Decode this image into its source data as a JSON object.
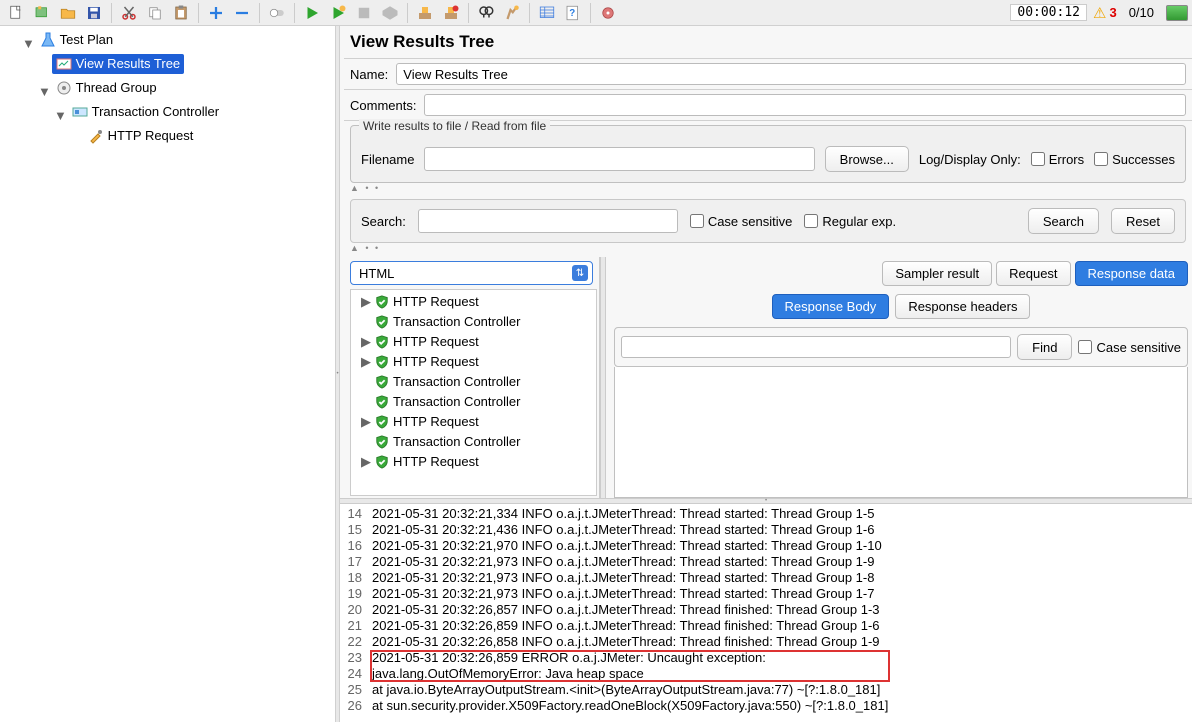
{
  "toolbar": {
    "timer": "00:00:12",
    "warn_count": "3",
    "ratio": "0/10"
  },
  "tree": {
    "root": "Test Plan",
    "view_results": "View Results Tree",
    "thread_group": "Thread Group",
    "txn_ctrl": "Transaction Controller",
    "http_req": "HTTP Request"
  },
  "panel": {
    "title": "View Results Tree",
    "name_label": "Name:",
    "name_value": "View Results Tree",
    "comments_label": "Comments:",
    "fieldset_legend": "Write results to file / Read from file",
    "filename_label": "Filename",
    "browse": "Browse...",
    "logdisplay": "Log/Display Only:",
    "errors": "Errors",
    "successes": "Successes",
    "search_label": "Search:",
    "case_sensitive": "Case sensitive",
    "regular_exp": "Regular exp.",
    "search_btn": "Search",
    "reset_btn": "Reset",
    "combo_value": "HTML",
    "tabs": {
      "sampler": "Sampler result",
      "request": "Request",
      "response": "Response data"
    },
    "subtabs": {
      "body": "Response Body",
      "headers": "Response headers"
    },
    "find": "Find",
    "results": [
      {
        "t": "HTTP Request",
        "exp": true
      },
      {
        "t": "Transaction Controller",
        "exp": false
      },
      {
        "t": "HTTP Request",
        "exp": true
      },
      {
        "t": "HTTP Request",
        "exp": true
      },
      {
        "t": "Transaction Controller",
        "exp": false
      },
      {
        "t": "Transaction Controller",
        "exp": false
      },
      {
        "t": "HTTP Request",
        "exp": true
      },
      {
        "t": "Transaction Controller",
        "exp": false
      },
      {
        "t": "HTTP Request",
        "exp": true
      }
    ]
  },
  "log": [
    {
      "n": "14",
      "t": "2021-05-31 20:32:21,334 INFO o.a.j.t.JMeterThread: Thread started: Thread Group 1-5"
    },
    {
      "n": "15",
      "t": "2021-05-31 20:32:21,436 INFO o.a.j.t.JMeterThread: Thread started: Thread Group 1-6"
    },
    {
      "n": "16",
      "t": "2021-05-31 20:32:21,970 INFO o.a.j.t.JMeterThread: Thread started: Thread Group 1-10"
    },
    {
      "n": "17",
      "t": "2021-05-31 20:32:21,973 INFO o.a.j.t.JMeterThread: Thread started: Thread Group 1-9"
    },
    {
      "n": "18",
      "t": "2021-05-31 20:32:21,973 INFO o.a.j.t.JMeterThread: Thread started: Thread Group 1-8"
    },
    {
      "n": "19",
      "t": "2021-05-31 20:32:21,973 INFO o.a.j.t.JMeterThread: Thread started: Thread Group 1-7"
    },
    {
      "n": "20",
      "t": "2021-05-31 20:32:26,857 INFO o.a.j.t.JMeterThread: Thread finished: Thread Group 1-3"
    },
    {
      "n": "21",
      "t": "2021-05-31 20:32:26,859 INFO o.a.j.t.JMeterThread: Thread finished: Thread Group 1-6"
    },
    {
      "n": "22",
      "t": "2021-05-31 20:32:26,858 INFO o.a.j.t.JMeterThread: Thread finished: Thread Group 1-9"
    },
    {
      "n": "23",
      "t": "2021-05-31 20:32:26,859 ERROR o.a.j.JMeter: Uncaught exception:"
    },
    {
      "n": "24",
      "t": "java.lang.OutOfMemoryError: Java heap space"
    },
    {
      "n": "25",
      "t": "    at java.io.ByteArrayOutputStream.<init>(ByteArrayOutputStream.java:77) ~[?:1.8.0_181]"
    },
    {
      "n": "26",
      "t": "    at sun.security.provider.X509Factory.readOneBlock(X509Factory.java:550) ~[?:1.8.0_181]"
    }
  ]
}
